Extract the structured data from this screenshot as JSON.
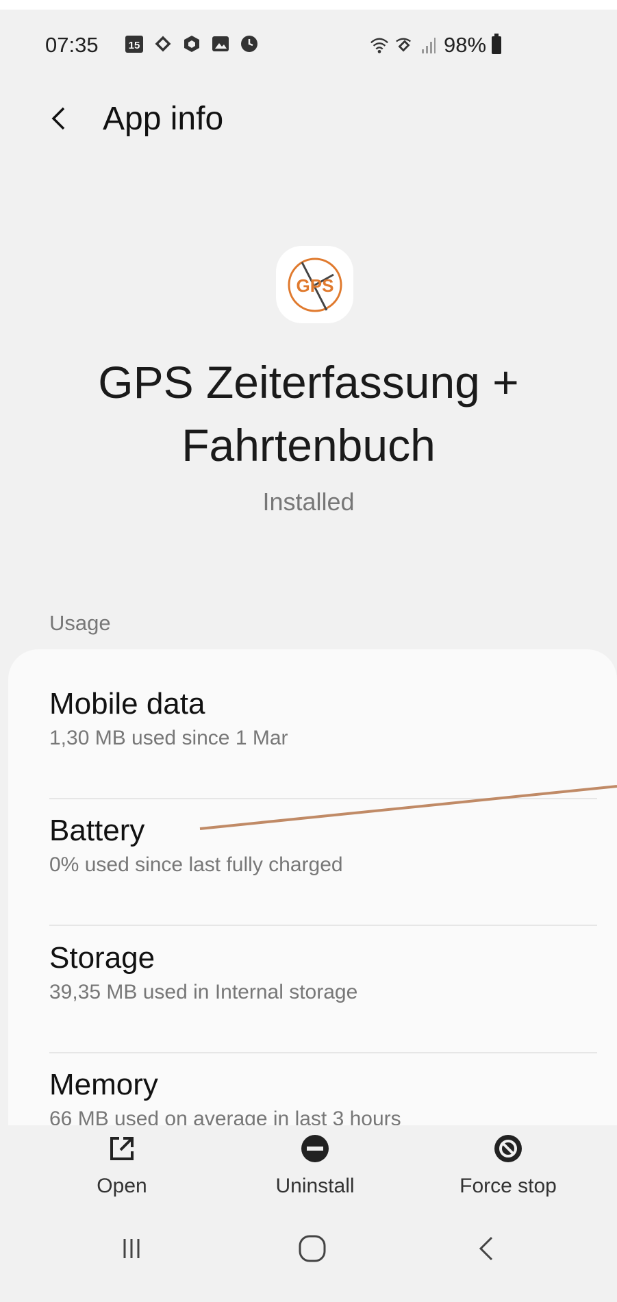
{
  "status_bar": {
    "time": "07:35",
    "calendar_day": "15",
    "battery_percent": "98%",
    "icons": [
      "calendar-icon",
      "call-icon",
      "box-icon",
      "gallery-icon",
      "clock-icon",
      "wifi-icon",
      "wifi-call-icon",
      "signal-icon",
      "battery-icon"
    ]
  },
  "app_bar": {
    "title": "App info"
  },
  "app": {
    "icon_text": "GPS",
    "name": "GPS Zeiterfassung + Fahrtenbuch",
    "status": "Installed",
    "accent_color": "#e07a2e"
  },
  "usage": {
    "label": "Usage",
    "items": [
      {
        "title": "Mobile data",
        "subtitle": "1,30 MB used since 1 Mar"
      },
      {
        "title": "Battery",
        "subtitle": "0% used since last fully charged"
      },
      {
        "title": "Storage",
        "subtitle": "39,35 MB used in Internal storage"
      },
      {
        "title": "Memory",
        "subtitle": "66 MB used on average in last 3 hours"
      }
    ]
  },
  "actions": [
    {
      "label": "Open",
      "icon": "open-external-icon"
    },
    {
      "label": "Uninstall",
      "icon": "uninstall-icon"
    },
    {
      "label": "Force stop",
      "icon": "force-stop-icon"
    }
  ],
  "nav": [
    "recents-icon",
    "home-icon",
    "back-icon"
  ],
  "annotation_color": "#c08a66"
}
